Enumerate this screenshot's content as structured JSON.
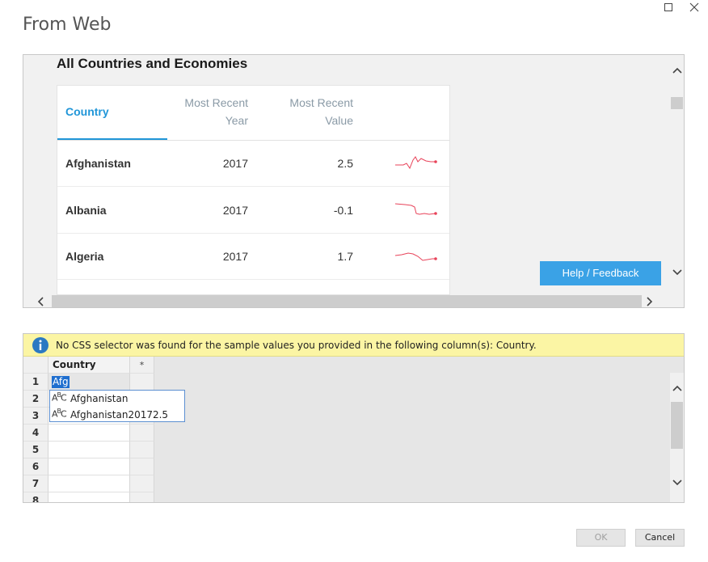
{
  "window": {
    "title": "From Web"
  },
  "preview": {
    "heading": "All Countries and Economies",
    "columns": {
      "country": "Country",
      "year_line1": "Most Recent",
      "year_line2": "Year",
      "value_line1": "Most Recent",
      "value_line2": "Value"
    },
    "rows": [
      {
        "country": "Afghanistan",
        "year": "2017",
        "value": "2.5"
      },
      {
        "country": "Albania",
        "year": "2017",
        "value": "-0.1"
      },
      {
        "country": "Algeria",
        "year": "2017",
        "value": "1.7"
      }
    ],
    "help_button": "Help / Feedback",
    "sparkline_color": "#e8435a",
    "accent_color": "#2196d8"
  },
  "notice": {
    "text": "No CSS selector was found for the sample values you provided in the following column(s): Country."
  },
  "grid": {
    "column_header": "Country",
    "add_column_header": "*",
    "row_numbers": [
      "1",
      "2",
      "3",
      "4",
      "5",
      "6",
      "7",
      "8"
    ],
    "editing_value": "Afg",
    "suggestions": [
      "Afghanistan",
      "Afghanistan20172.5"
    ],
    "suggestion_type_icon": "ABC"
  },
  "buttons": {
    "ok": "OK",
    "cancel": "Cancel"
  }
}
